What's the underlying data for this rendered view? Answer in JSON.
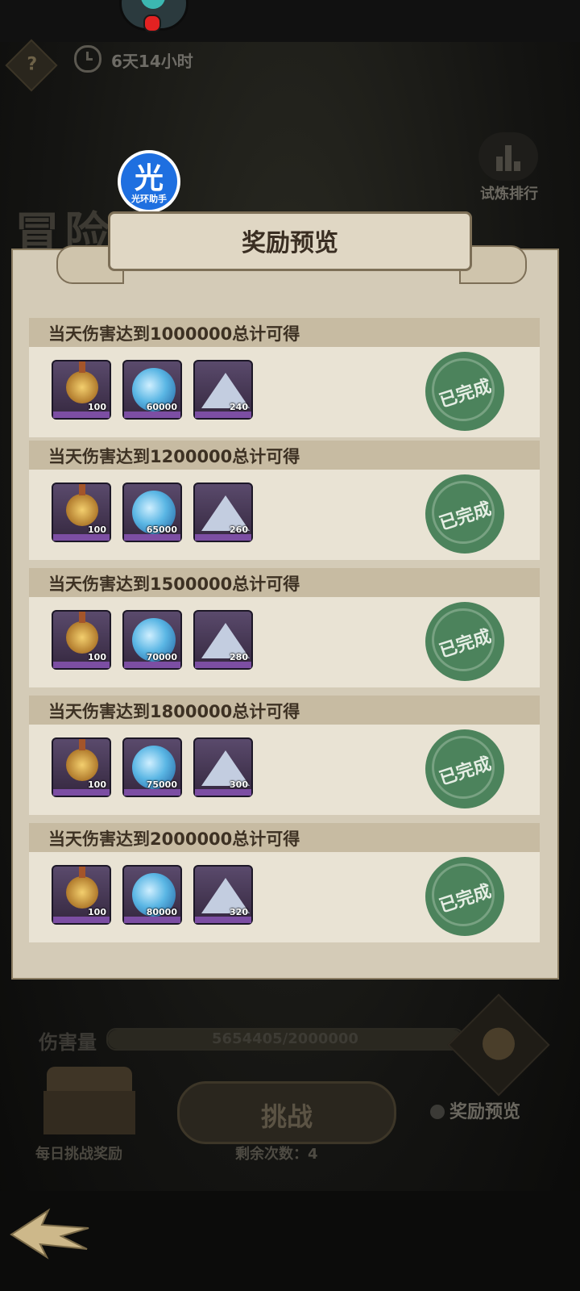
{
  "header": {
    "timer": "6天14小时",
    "help_icon": "question-icon"
  },
  "background_title": "冒险家",
  "rank": {
    "label": "试炼排行"
  },
  "assistant": {
    "big": "光",
    "small": "光环助手"
  },
  "modal": {
    "title": "奖励预览",
    "rewards": [
      {
        "title": "当天伤害达到1000000总计可得",
        "items": [
          "100",
          "60000",
          "240"
        ],
        "status": "已完成"
      },
      {
        "title": "当天伤害达到1200000总计可得",
        "items": [
          "100",
          "65000",
          "260"
        ],
        "status": "已完成"
      },
      {
        "title": "当天伤害达到1500000总计可得",
        "items": [
          "100",
          "70000",
          "280"
        ],
        "status": "已完成"
      },
      {
        "title": "当天伤害达到1800000总计可得",
        "items": [
          "100",
          "75000",
          "300"
        ],
        "status": "已完成"
      },
      {
        "title": "当天伤害达到2000000总计可得",
        "items": [
          "100",
          "80000",
          "320"
        ],
        "status": "已完成"
      }
    ]
  },
  "footer": {
    "damage_label": "伤害量",
    "damage_text": "5654405/2000000",
    "damage_progress": 1.0,
    "daily_reward_label": "每日挑战奖励",
    "challenge_label": "挑战",
    "remaining": "剩余次数：4",
    "preview_label": "奖励预览"
  }
}
